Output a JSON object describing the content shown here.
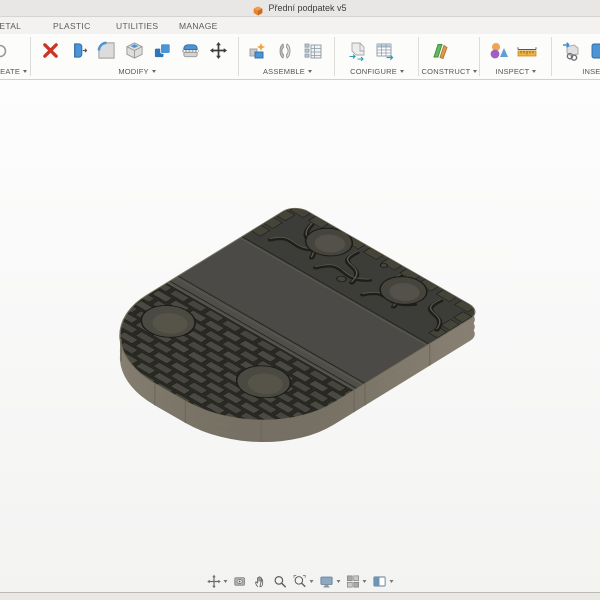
{
  "titlebar": {
    "title": "Přední podpatek v5"
  },
  "tabs": {
    "metal": "METAL",
    "plastic": "PLASTIC",
    "utilities": "UTILITIES",
    "manage": "MANAGE"
  },
  "toolbar": {
    "groups": {
      "create": {
        "label": "CREATE",
        "icons": [
          "create-partial-circle"
        ]
      },
      "modify": {
        "label": "MODIFY",
        "icons": [
          "delete",
          "press-pull",
          "fillet",
          "shell",
          "combine",
          "split-body",
          "move-copy"
        ]
      },
      "assemble": {
        "label": "ASSEMBLE",
        "icons": [
          "new-component",
          "joint",
          "rigid-group"
        ]
      },
      "configure": {
        "label": "CONFIGURE",
        "icons": [
          "configure-design",
          "configuration-table"
        ]
      },
      "construct": {
        "label": "CONSTRUCT",
        "icons": [
          "construct-plane"
        ]
      },
      "inspect": {
        "label": "INSPECT",
        "icons": [
          "measure-primitives",
          "measure-ruler"
        ]
      },
      "insert": {
        "label": "INSERT",
        "icons": [
          "derive",
          "insert-partial"
        ]
      }
    }
  },
  "canvas": {
    "model": {
      "name": "heel-plate-3d-model",
      "top_face_color": "#4b4a46",
      "tread_color": "#3c3c38",
      "brick_color": "#4b4a42",
      "side_wall_color": "#8c8779"
    }
  },
  "navbar": {
    "items": [
      "orbit",
      "look-at",
      "pan",
      "zoom",
      "fit",
      "display-settings",
      "grid-and-snaps",
      "viewports"
    ]
  },
  "colors": {
    "accent_orange": "#e8822e",
    "titlebar_bg": "#e9e7e5",
    "tabs_bg": "#f4f2f0",
    "toolbar_bg": "#fcfcfb",
    "canvas_bg": "#fbfbfa",
    "footer_bg": "#eae8e5"
  }
}
